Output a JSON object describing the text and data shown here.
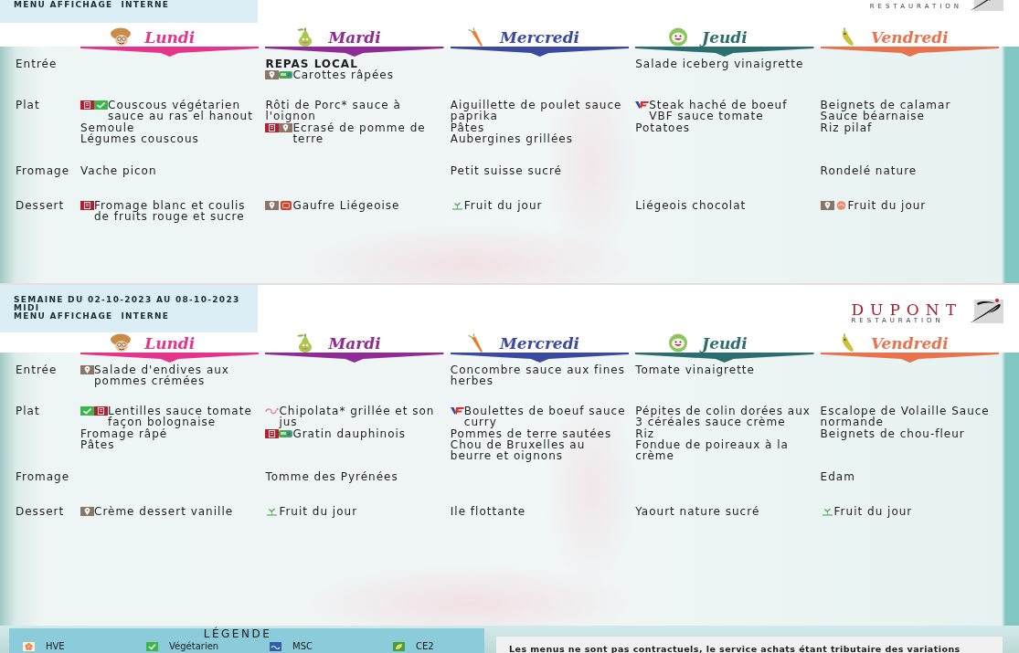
{
  "pages": [
    {
      "header_lines": [
        "MENU AFFICHAGE  INTERNE"
      ],
      "logo": {
        "tagline": "RESTAURATION"
      },
      "days": [
        {
          "name": "Lundi",
          "color": "#e5358b",
          "kind": "mushroom"
        },
        {
          "name": "Mardi",
          "color": "#8e2b96",
          "kind": "pear"
        },
        {
          "name": "Mercredi",
          "color": "#3b4a9f",
          "kind": "carrot"
        },
        {
          "name": "Jeudi",
          "color": "#2c6e70",
          "kind": "lettuce"
        },
        {
          "name": "Vendredi",
          "color": "#e9724f",
          "kind": "bean"
        }
      ],
      "rows": [
        {
          "label": "Entrée",
          "cells": [
            {},
            {
              "items": [
                {
                  "kind": "note",
                  "text": "REPAS LOCAL"
                },
                {
                  "kind": "dish",
                  "text": "Carottes râpées",
                  "labels": [
                    {
                      "kind": "pin"
                    },
                    {
                      "kind": "tag"
                    }
                  ]
                }
              ]
            },
            {},
            {
              "items": [
                {
                  "kind": "dish",
                  "text": "Salade iceberg vinaigrette"
                }
              ]
            },
            {}
          ]
        },
        {
          "label": "Plat",
          "cells": [
            {
              "items": [
                {
                  "kind": "dish",
                  "text": "Couscous végétarien sauce au ras el hanout",
                  "labels": [
                    {
                      "kind": "book"
                    },
                    {
                      "kind": "check"
                    }
                  ]
                },
                {
                  "kind": "dish",
                  "text": "Semoule"
                },
                {
                  "kind": "dish",
                  "text": "Légumes couscous"
                }
              ]
            },
            {
              "items": [
                {
                  "kind": "dish",
                  "text": "Rôti de Porc* sauce à l'oignon"
                },
                {
                  "kind": "dish",
                  "text": "Ecrasé de pomme de terre",
                  "labels": [
                    {
                      "kind": "book"
                    },
                    {
                      "kind": "pin"
                    }
                  ]
                }
              ]
            },
            {
              "items": [
                {
                  "kind": "dish",
                  "text": "Aiguillette de poulet sauce paprika"
                },
                {
                  "kind": "dish",
                  "text": "Pâtes"
                },
                {
                  "kind": "dish",
                  "text": "Aubergines grillées"
                }
              ]
            },
            {
              "items": [
                {
                  "kind": "dish",
                  "text": "Steak haché de boeuf VBF sauce tomate",
                  "labels": [
                    {
                      "kind": "flag"
                    }
                  ]
                },
                {
                  "kind": "dish",
                  "text": "Potatoes"
                }
              ]
            },
            {
              "items": [
                {
                  "kind": "dish",
                  "text": "Beignets de calamar"
                },
                {
                  "kind": "dish",
                  "text": "Sauce béarnaise"
                },
                {
                  "kind": "dish",
                  "text": "Riz pilaf"
                }
              ]
            }
          ]
        },
        {
          "label": "Fromage",
          "cells": [
            {
              "items": [
                {
                  "kind": "dish",
                  "text": "Vache picon"
                }
              ]
            },
            {},
            {
              "items": [
                {
                  "kind": "dish",
                  "text": "Petit suisse sucré"
                }
              ]
            },
            {},
            {
              "items": [
                {
                  "kind": "dish",
                  "text": "Rondelé nature"
                }
              ]
            }
          ]
        },
        {
          "label": "Dessert",
          "cells": [
            {
              "items": [
                {
                  "kind": "dish",
                  "text": "Fromage blanc et coulis de fruits rouge et sucre",
                  "labels": [
                    {
                      "kind": "book"
                    }
                  ]
                }
              ]
            },
            {
              "items": [
                {
                  "kind": "dish",
                  "text": "Gaufre Liégeoise",
                  "labels": [
                    {
                      "kind": "pin"
                    },
                    {
                      "kind": "stamp"
                    }
                  ]
                }
              ]
            },
            {
              "items": [
                {
                  "kind": "dish",
                  "text": "Fruit du jour",
                  "labels": [
                    {
                      "kind": "sprout"
                    }
                  ]
                }
              ]
            },
            {
              "items": [
                {
                  "kind": "dish",
                  "text": "Liégeois chocolat"
                }
              ]
            },
            {
              "items": [
                {
                  "kind": "dish",
                  "text": "Fruit du jour",
                  "labels": [
                    {
                      "kind": "pin"
                    },
                    {
                      "kind": "fruit"
                    }
                  ]
                }
              ]
            }
          ]
        }
      ]
    },
    {
      "header_lines": [
        "SEMAINE DU 02-10-2023 AU 08-10-2023",
        "MIDI",
        "MENU AFFICHAGE  INTERNE"
      ],
      "logo": {
        "name": "DUPONT",
        "tagline": "RESTAURATION"
      },
      "days": [
        {
          "name": "Lundi",
          "color": "#e5358b",
          "kind": "mushroom"
        },
        {
          "name": "Mardi",
          "color": "#8e2b96",
          "kind": "pear"
        },
        {
          "name": "Mercredi",
          "color": "#3b4a9f",
          "kind": "carrot"
        },
        {
          "name": "Jeudi",
          "color": "#2c6e70",
          "kind": "lettuce"
        },
        {
          "name": "Vendredi",
          "color": "#e9724f",
          "kind": "bean"
        }
      ],
      "rows": [
        {
          "label": "Entrée",
          "cells": [
            {
              "items": [
                {
                  "kind": "dish",
                  "text": "Salade d'endives aux pommes crémées",
                  "labels": [
                    {
                      "kind": "pin"
                    }
                  ]
                }
              ]
            },
            {},
            {
              "items": [
                {
                  "kind": "dish",
                  "text": "Concombre sauce aux fines herbes"
                }
              ]
            },
            {
              "items": [
                {
                  "kind": "dish",
                  "text": "Tomate vinaigrette"
                }
              ]
            },
            {}
          ]
        },
        {
          "label": "Plat",
          "cells": [
            {
              "items": [
                {
                  "kind": "dish",
                  "text": "Lentilles sauce tomate façon bolognaise",
                  "labels": [
                    {
                      "kind": "check"
                    },
                    {
                      "kind": "book"
                    }
                  ]
                },
                {
                  "kind": "dish",
                  "text": "Fromage râpé"
                },
                {
                  "kind": "dish",
                  "text": "Pâtes"
                }
              ]
            },
            {
              "items": [
                {
                  "kind": "dish",
                  "text": "Chipolata* grillée et son jus",
                  "labels": [
                    {
                      "kind": "curl"
                    }
                  ]
                },
                {
                  "kind": "dish",
                  "text": "Gratin dauphinois",
                  "labels": [
                    {
                      "kind": "book"
                    },
                    {
                      "kind": "tag"
                    }
                  ]
                }
              ]
            },
            {
              "items": [
                {
                  "kind": "dish",
                  "text": "Boulettes de boeuf sauce curry",
                  "labels": [
                    {
                      "kind": "flag"
                    }
                  ]
                },
                {
                  "kind": "dish",
                  "text": "Pommes de terre sautées"
                },
                {
                  "kind": "dish",
                  "text": "Chou de Bruxelles au beurre et oignons"
                }
              ]
            },
            {
              "items": [
                {
                  "kind": "dish",
                  "text": "Pépites de colin dorées aux 3 céréales sauce crème"
                },
                {
                  "kind": "dish",
                  "text": "Riz"
                },
                {
                  "kind": "dish",
                  "text": "Fondue de poireaux à la crème"
                }
              ]
            },
            {
              "items": [
                {
                  "kind": "dish",
                  "text": "Escalope de Volaille Sauce normande"
                },
                {
                  "kind": "dish",
                  "text": "Beignets de chou-fleur"
                }
              ]
            }
          ]
        },
        {
          "label": "Fromage",
          "cells": [
            {},
            {
              "items": [
                {
                  "kind": "dish",
                  "text": "Tomme des Pyrénées"
                }
              ]
            },
            {},
            {},
            {
              "items": [
                {
                  "kind": "dish",
                  "text": "Edam"
                }
              ]
            }
          ]
        },
        {
          "label": "Dessert",
          "cells": [
            {
              "items": [
                {
                  "kind": "dish",
                  "text": "Crème dessert vanille",
                  "labels": [
                    {
                      "kind": "pin"
                    }
                  ]
                }
              ]
            },
            {
              "items": [
                {
                  "kind": "dish",
                  "text": "Fruit du jour",
                  "labels": [
                    {
                      "kind": "sprout"
                    }
                  ]
                }
              ]
            },
            {
              "items": [
                {
                  "kind": "dish",
                  "text": "Ile flottante"
                }
              ]
            },
            {
              "items": [
                {
                  "kind": "dish",
                  "text": "Yaourt nature sucré"
                }
              ]
            },
            {
              "items": [
                {
                  "kind": "dish",
                  "text": "Fruit du jour",
                  "labels": [
                    {
                      "kind": "sprout"
                    }
                  ]
                }
              ]
            }
          ]
        }
      ]
    }
  ],
  "legend": {
    "title": "LÉGENDE",
    "items": [
      {
        "kind": "hve",
        "label": "HVE"
      },
      {
        "kind": "vegetarian",
        "label": "Végétarien"
      },
      {
        "kind": "msc",
        "label": "MSC"
      },
      {
        "kind": "ce2",
        "label": "CE2"
      }
    ]
  },
  "disclaimer": "Les menus ne sont pas contractuels, le service achats étant tributaire des variations"
}
